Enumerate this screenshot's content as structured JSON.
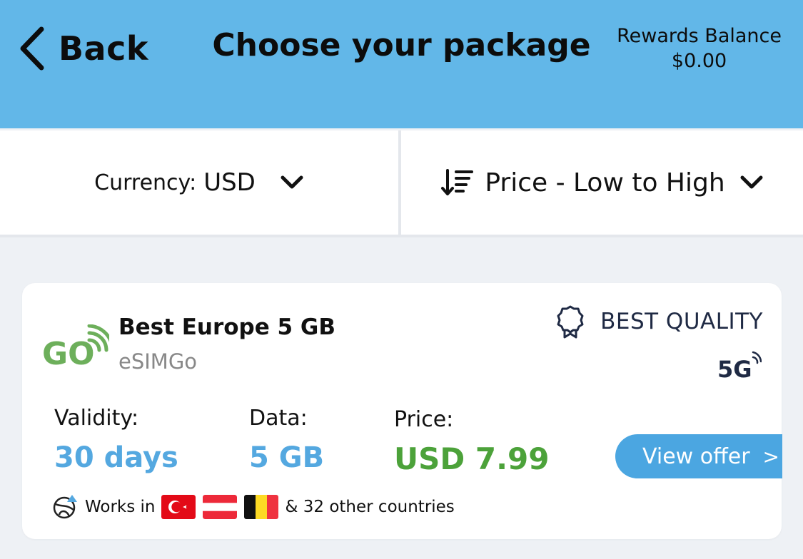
{
  "header": {
    "back_label": "Back",
    "title": "Choose your package",
    "rewards_label": "Rewards Balance",
    "rewards_value": "$0.00",
    "background_color": "#62b7e8"
  },
  "filters": {
    "currency_label": "Currency:",
    "currency_value": "USD",
    "sort_value": "Price - Low to High"
  },
  "card": {
    "logo_text": "GO",
    "package_name": "Best Europe 5 GB",
    "provider": "eSIMGo",
    "quality_label": "BEST QUALITY",
    "network": "5G",
    "validity_label": "Validity:",
    "validity_value": "30 days",
    "data_label": "Data:",
    "data_value": "5 GB",
    "price_label": "Price:",
    "price_value": "USD 7.99",
    "cta_label": "View offer",
    "cta_arrow": ">",
    "works_label": "Works in",
    "flags": [
      "turkey-flag",
      "austria-flag",
      "belgium-flag"
    ],
    "other_countries": "& 32 other countries",
    "accent_color": "#54a8e0",
    "price_color": "#4ca23a"
  }
}
